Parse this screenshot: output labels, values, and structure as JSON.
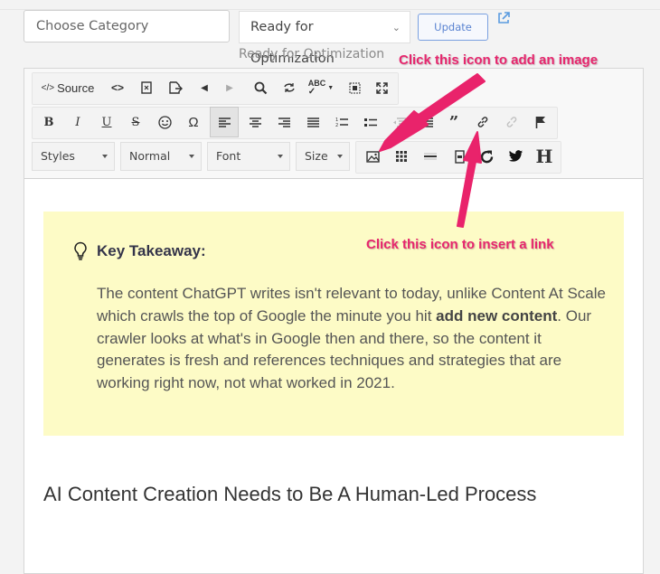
{
  "category": {
    "placeholder": "Choose Category"
  },
  "status": {
    "selected": "Ready for Optimization",
    "label": "Ready for Optimization"
  },
  "update_button": "Update",
  "toolbar": {
    "source_label": "Source",
    "styles": "Styles",
    "format": "Normal",
    "font": "Font",
    "size": "Size",
    "row1_icons": [
      "source-icon",
      "code-icon",
      "document-icon",
      "export-icon",
      "undo-icon",
      "redo-icon",
      "find-icon",
      "replace-icon",
      "spellcheck-icon",
      "select-all-icon",
      "maximize-icon"
    ],
    "row2_icons": [
      "bold-icon",
      "italic-icon",
      "underline-icon",
      "strikethrough-icon",
      "emoji-icon",
      "omega-icon",
      "align-left-icon",
      "align-center-icon",
      "align-right-icon",
      "justify-icon",
      "numbered-list-icon",
      "bullet-list-icon",
      "outdent-icon",
      "indent-icon",
      "blockquote-icon",
      "link-icon",
      "unlink-icon",
      "anchor-icon"
    ],
    "row3_icons": [
      "image-icon",
      "table-icon",
      "horizontal-rule-icon",
      "page-break-icon",
      "refresh-icon",
      "twitter-icon",
      "heading-icon"
    ]
  },
  "callout": {
    "title": "Key Takeaway:",
    "text_1": "The content ChatGPT writes isn't relevant to today, unlike Content At Scale which crawls the top of Google the minute you hit ",
    "bold": "add new content",
    "text_2": ". Our crawler looks at what's in Google then and there, so the content it generates is fresh and references techniques and strategies that are working right now, not what worked in 2021."
  },
  "heading": "AI Content Creation Needs to Be A Human-Led Process",
  "annotations": {
    "image": "Click this icon to add an image",
    "link": "Click this icon to insert a link"
  },
  "colors": {
    "annotation": "#e6266d",
    "callout_bg": "#fdfbc6",
    "update_button": "#5a83d1"
  }
}
